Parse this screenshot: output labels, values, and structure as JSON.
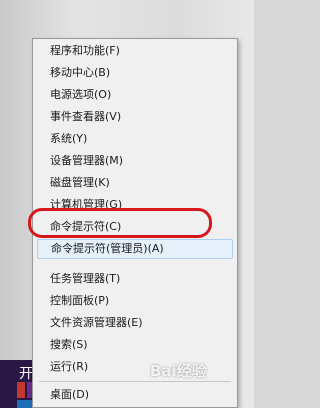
{
  "taskbar": {
    "start_label": "开"
  },
  "menu": {
    "items": [
      {
        "label": "程序和功能(F)"
      },
      {
        "label": "移动中心(B)"
      },
      {
        "label": "电源选项(O)"
      },
      {
        "label": "事件查看器(V)"
      },
      {
        "label": "系统(Y)"
      },
      {
        "label": "设备管理器(M)"
      },
      {
        "label": "磁盘管理(K)"
      },
      {
        "label": "计算机管理(G)"
      },
      {
        "label": "命令提示符(C)"
      },
      {
        "label": "命令提示符(管理员)(A)",
        "highlighted": true
      },
      {
        "label": "任务管理器(T)"
      },
      {
        "label": "控制面板(P)"
      },
      {
        "label": "文件资源管理器(E)"
      },
      {
        "label": "搜索(S)"
      },
      {
        "label": "运行(R)"
      },
      {
        "label": "桌面(D)"
      }
    ]
  },
  "watermark": {
    "text": "Bai经验"
  },
  "colors": {
    "highlight_ring": "#d6181c",
    "menu_bg": "#f0f0f0"
  }
}
